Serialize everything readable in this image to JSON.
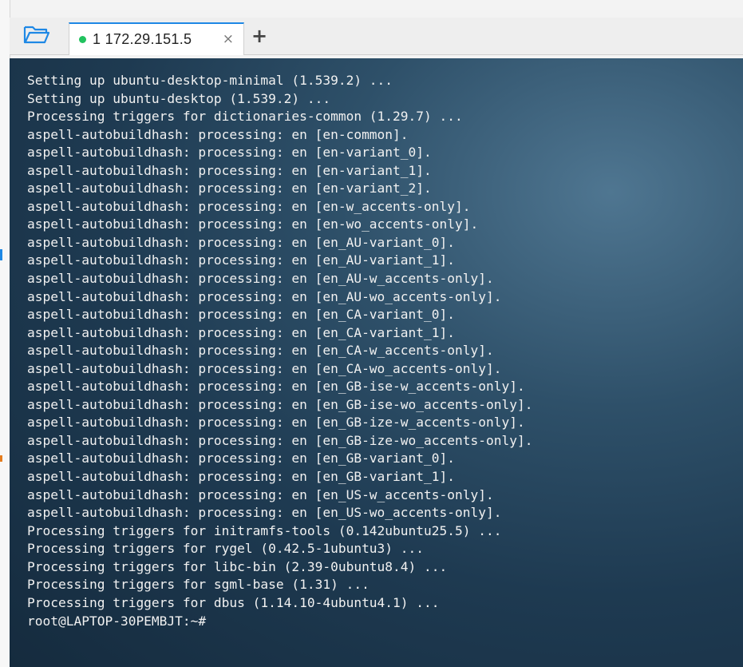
{
  "tabbar": {
    "folder_icon": "folder-open-icon",
    "tabs": [
      {
        "label": "1 172.29.151.5",
        "status": "connected",
        "status_color": "#21c25e",
        "close_glyph": "×"
      }
    ],
    "add_glyph": "+"
  },
  "terminal": {
    "lines": [
      "Setting up ubuntu-desktop-minimal (1.539.2) ...",
      "Setting up ubuntu-desktop (1.539.2) ...",
      "Processing triggers for dictionaries-common (1.29.7) ...",
      "aspell-autobuildhash: processing: en [en-common].",
      "aspell-autobuildhash: processing: en [en-variant_0].",
      "aspell-autobuildhash: processing: en [en-variant_1].",
      "aspell-autobuildhash: processing: en [en-variant_2].",
      "aspell-autobuildhash: processing: en [en-w_accents-only].",
      "aspell-autobuildhash: processing: en [en-wo_accents-only].",
      "aspell-autobuildhash: processing: en [en_AU-variant_0].",
      "aspell-autobuildhash: processing: en [en_AU-variant_1].",
      "aspell-autobuildhash: processing: en [en_AU-w_accents-only].",
      "aspell-autobuildhash: processing: en [en_AU-wo_accents-only].",
      "aspell-autobuildhash: processing: en [en_CA-variant_0].",
      "aspell-autobuildhash: processing: en [en_CA-variant_1].",
      "aspell-autobuildhash: processing: en [en_CA-w_accents-only].",
      "aspell-autobuildhash: processing: en [en_CA-wo_accents-only].",
      "aspell-autobuildhash: processing: en [en_GB-ise-w_accents-only].",
      "aspell-autobuildhash: processing: en [en_GB-ise-wo_accents-only].",
      "aspell-autobuildhash: processing: en [en_GB-ize-w_accents-only].",
      "aspell-autobuildhash: processing: en [en_GB-ize-wo_accents-only].",
      "aspell-autobuildhash: processing: en [en_GB-variant_0].",
      "aspell-autobuildhash: processing: en [en_GB-variant_1].",
      "aspell-autobuildhash: processing: en [en_US-w_accents-only].",
      "aspell-autobuildhash: processing: en [en_US-wo_accents-only].",
      "Processing triggers for initramfs-tools (0.142ubuntu25.5) ...",
      "Processing triggers for rygel (0.42.5-1ubuntu3) ...",
      "Processing triggers for libc-bin (2.39-0ubuntu8.4) ...",
      "Processing triggers for sgml-base (1.31) ...",
      "Processing triggers for dbus (1.14.10-4ubuntu4.1) ..."
    ],
    "prompt": "root@LAPTOP-30PEMBJT:~#"
  }
}
